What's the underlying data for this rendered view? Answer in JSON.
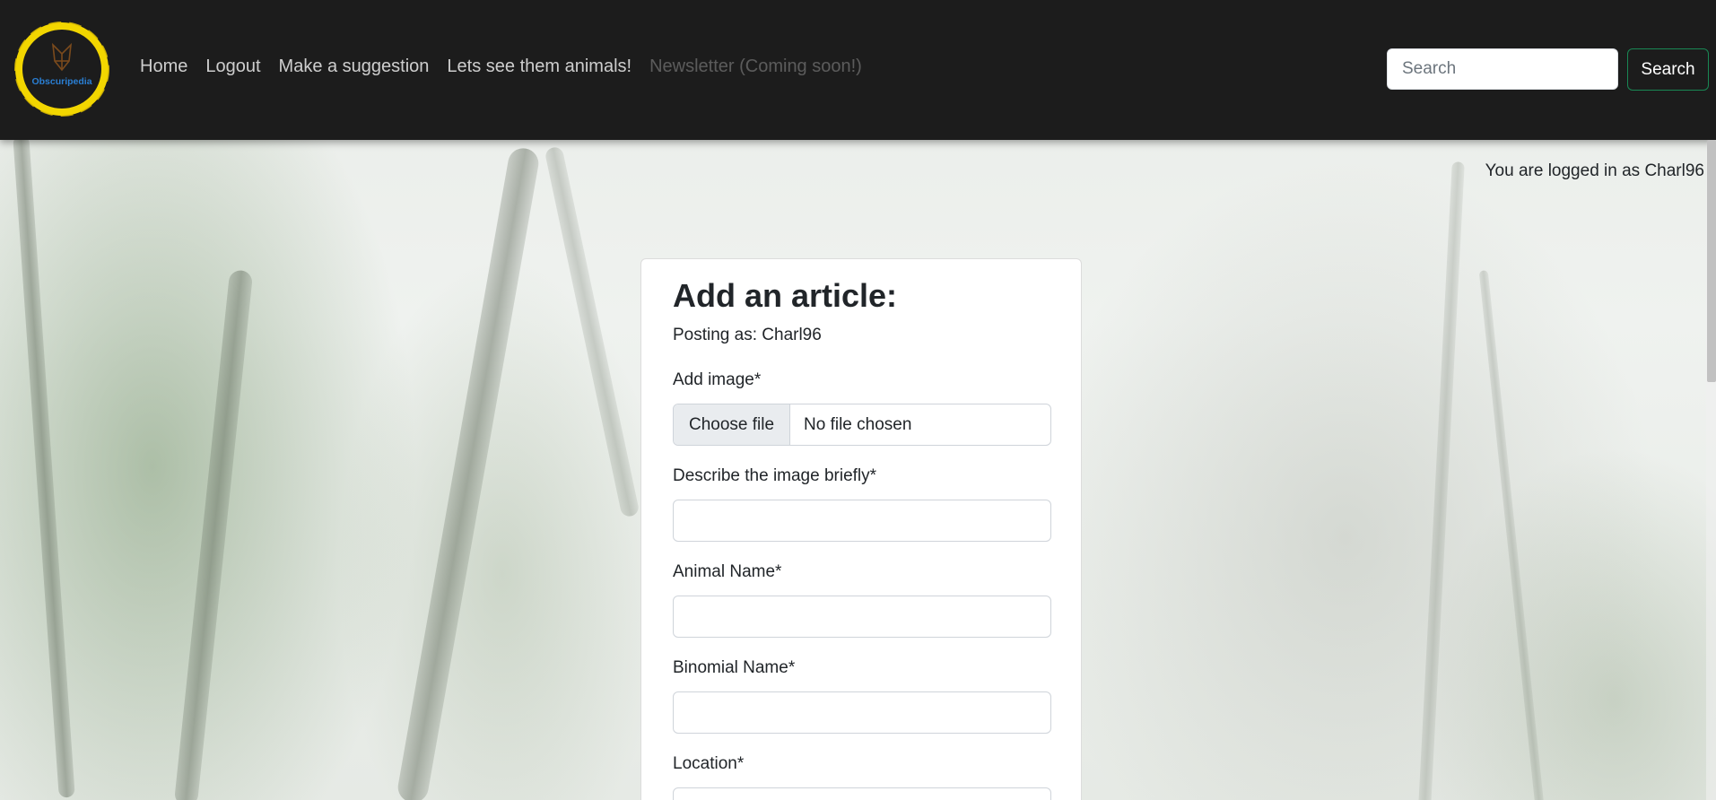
{
  "navbar": {
    "logo_text": "Obscuripedia",
    "links": [
      {
        "label": "Home",
        "state": "normal"
      },
      {
        "label": "Logout",
        "state": "normal"
      },
      {
        "label": "Make a suggestion",
        "state": "normal"
      },
      {
        "label": "Lets see them animals!",
        "state": "normal"
      },
      {
        "label": "Newsletter (Coming soon!)",
        "state": "disabled"
      }
    ],
    "search": {
      "placeholder": "Search",
      "value": "",
      "button_label": "Search"
    }
  },
  "user_status": "You are logged in as Charl96",
  "form": {
    "title": "Add an article:",
    "posting_as": "Posting as: Charl96",
    "image_label": "Add image*",
    "file_button_label": "Choose file",
    "file_status": "No file chosen",
    "fields": [
      {
        "label": "Describe the image briefly*",
        "value": ""
      },
      {
        "label": "Animal Name*",
        "value": ""
      },
      {
        "label": "Binomial Name*",
        "value": ""
      },
      {
        "label": "Location*",
        "value": ""
      }
    ]
  },
  "colors": {
    "navbar_bg": "#1c1c1c",
    "logo_ring": "#f2d600",
    "logo_text": "#2a7fd4",
    "search_button_border": "#198754"
  },
  "icons": {
    "logo": "fox-head-emblem"
  }
}
